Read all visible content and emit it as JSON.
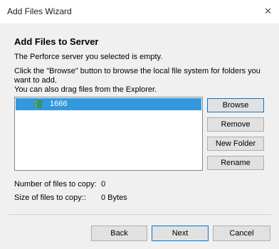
{
  "window": {
    "title": "Add Files Wizard",
    "close_glyph": "✕"
  },
  "header": {
    "title": "Add Files to Server"
  },
  "messages": {
    "empty": "The Perforce server you selected is empty.",
    "browse_line1": "Click the \"Browse\" button to browse the local file system for folders you",
    "browse_line2": "want to add.",
    "drag": "You can also drag files from the Explorer."
  },
  "list": {
    "items": [
      {
        "label": "1666",
        "icon": "server-icon",
        "selected": true
      }
    ],
    "selection_color": "#3399dd"
  },
  "side_buttons": {
    "browse": "Browse",
    "remove": "Remove",
    "new_folder": "New Folder",
    "rename": "Rename"
  },
  "stats": {
    "files_label": "Number of files to copy:",
    "files_value": "0",
    "size_label": "Size of files to copy::",
    "size_value": "0 Bytes"
  },
  "footer": {
    "back": "Back",
    "next": "Next",
    "cancel": "Cancel"
  }
}
